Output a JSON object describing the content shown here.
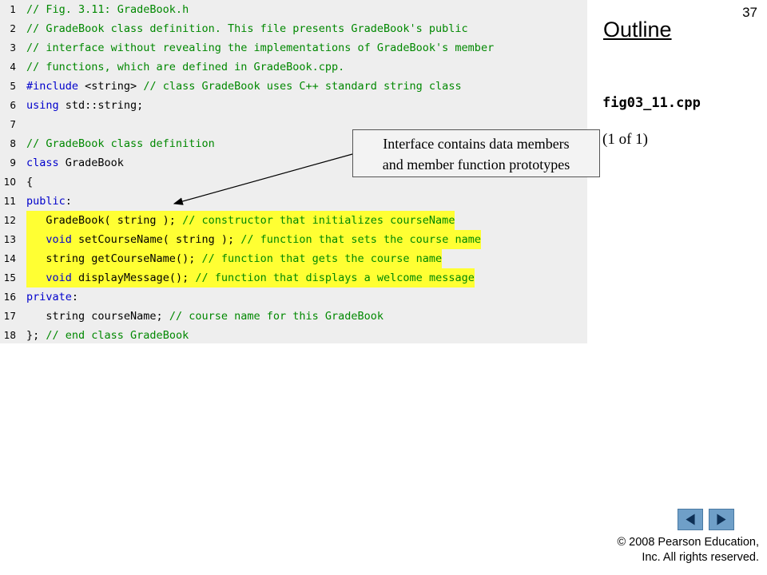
{
  "slide_number": "37",
  "outline": {
    "heading": "Outline",
    "file_name": "fig03_11.cpp",
    "page_indicator": "(1 of 1)"
  },
  "code_lines": [
    {
      "num": "1",
      "segments": [
        {
          "t": "// Fig. 3.11: GradeBook.h",
          "c": "cm"
        }
      ]
    },
    {
      "num": "2",
      "segments": [
        {
          "t": "// GradeBook class definition. This file presents GradeBook's public",
          "c": "cm"
        }
      ]
    },
    {
      "num": "3",
      "segments": [
        {
          "t": "// interface without revealing the implementations of GradeBook's member",
          "c": "cm"
        }
      ]
    },
    {
      "num": "4",
      "segments": [
        {
          "t": "// functions, which are defined in GradeBook.cpp.",
          "c": "cm"
        }
      ]
    },
    {
      "num": "5",
      "segments": [
        {
          "t": "#include",
          "c": "kw"
        },
        {
          "t": " <string> ",
          "c": "tx"
        },
        {
          "t": "// class GradeBook uses C++ standard string class",
          "c": "cm"
        }
      ]
    },
    {
      "num": "6",
      "segments": [
        {
          "t": "using",
          "c": "kw"
        },
        {
          "t": " std::string;",
          "c": "tx"
        }
      ]
    },
    {
      "num": "7",
      "segments": []
    },
    {
      "num": "8",
      "segments": [
        {
          "t": "// GradeBook class definition",
          "c": "cm"
        }
      ]
    },
    {
      "num": "9",
      "segments": [
        {
          "t": "class",
          "c": "kw"
        },
        {
          "t": " GradeBook",
          "c": "tx"
        }
      ]
    },
    {
      "num": "10",
      "segments": [
        {
          "t": "{",
          "c": "tx"
        }
      ]
    },
    {
      "num": "11",
      "segments": [
        {
          "t": "public",
          "c": "kw"
        },
        {
          "t": ":",
          "c": "tx"
        }
      ]
    },
    {
      "num": "12",
      "highlight": true,
      "segments": [
        {
          "t": "   GradeBook( string ); ",
          "c": "tx"
        },
        {
          "t": "// constructor that initializes courseName",
          "c": "cm"
        }
      ]
    },
    {
      "num": "13",
      "highlight": true,
      "segments": [
        {
          "t": "   ",
          "c": "tx"
        },
        {
          "t": "void",
          "c": "kw"
        },
        {
          "t": " setCourseName( string ); ",
          "c": "tx"
        },
        {
          "t": "// function that sets the course name",
          "c": "cm"
        }
      ]
    },
    {
      "num": "14",
      "highlight": true,
      "segments": [
        {
          "t": "   string getCourseName(); ",
          "c": "tx"
        },
        {
          "t": "// function that gets the course name",
          "c": "cm"
        }
      ]
    },
    {
      "num": "15",
      "highlight": true,
      "segments": [
        {
          "t": "   ",
          "c": "tx"
        },
        {
          "t": "void",
          "c": "kw"
        },
        {
          "t": " displayMessage(); ",
          "c": "tx"
        },
        {
          "t": "// function that displays a welcome message",
          "c": "cm"
        }
      ]
    },
    {
      "num": "16",
      "segments": [
        {
          "t": "private",
          "c": "kw"
        },
        {
          "t": ":",
          "c": "tx"
        }
      ]
    },
    {
      "num": "17",
      "segments": [
        {
          "t": "   string courseName; ",
          "c": "tx"
        },
        {
          "t": "// course name for this GradeBook",
          "c": "cm"
        }
      ]
    },
    {
      "num": "18",
      "segments": [
        {
          "t": "}; ",
          "c": "tx"
        },
        {
          "t": "// end class GradeBook",
          "c": "cm"
        }
      ]
    }
  ],
  "callout": {
    "line1": "Interface contains data members",
    "line2": "and member function prototypes"
  },
  "navigation": {
    "prev_icon": "triangle-left-icon",
    "next_icon": "triangle-right-icon",
    "color": "#6f9fc8"
  },
  "copyright": {
    "line1": "© 2008 Pearson Education,",
    "line2": "Inc.  All rights reserved."
  },
  "colors": {
    "keyword": "#0000cc",
    "comment": "#008800",
    "highlight": "#ffff33",
    "code_background": "#eeeeee"
  }
}
